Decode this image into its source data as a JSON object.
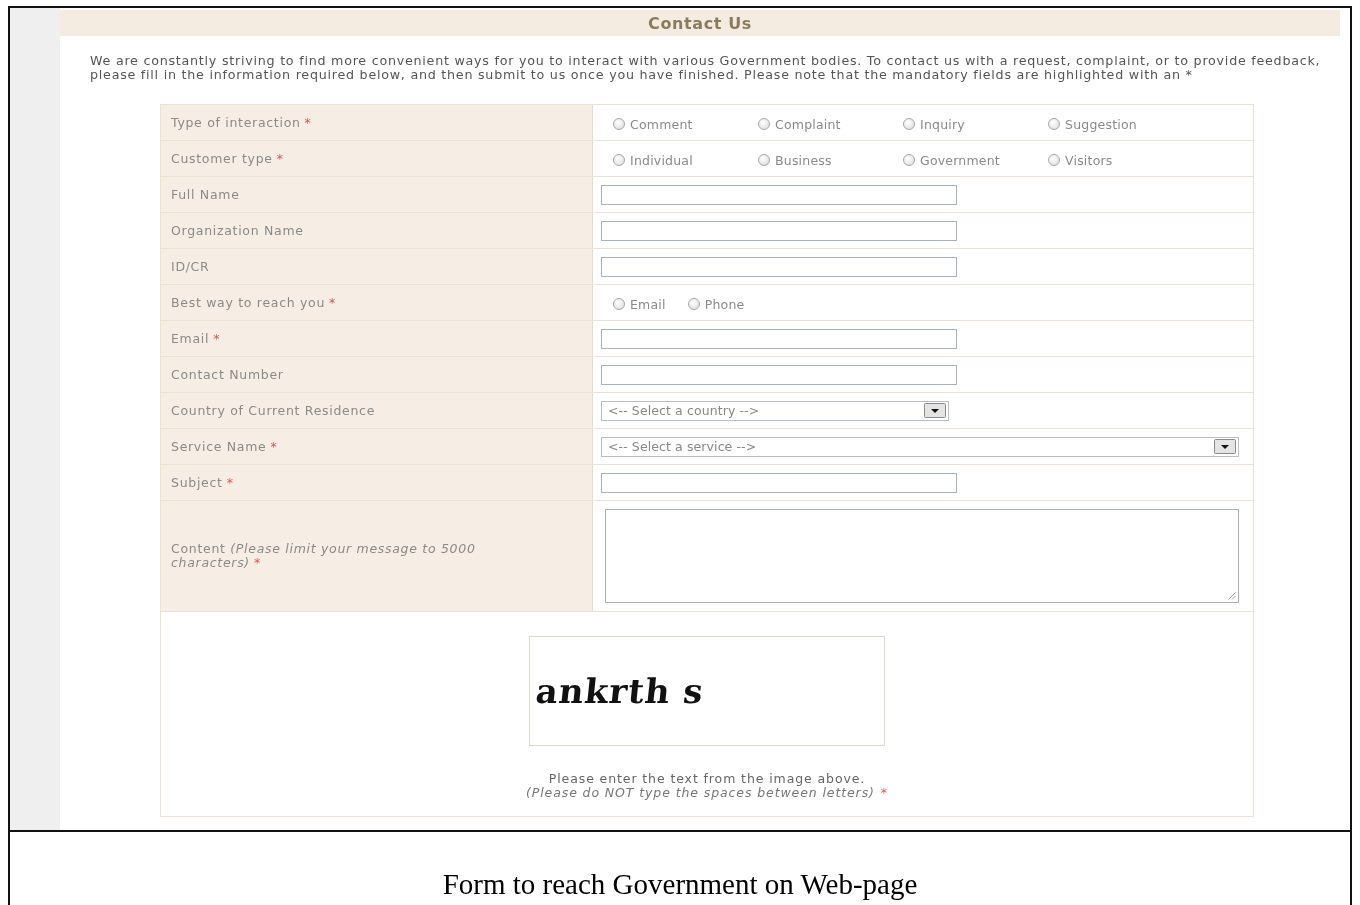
{
  "page": {
    "title": "Contact Us",
    "intro": "We are constantly striving to find more convenient ways for you to interact with various Government bodies. To contact us with a request, complaint, or to provide feedback, please fill in the information required below, and then submit to us once you have finished. Please note that the mandatory fields are highlighted with an *"
  },
  "fields": [
    {
      "kind": "radio",
      "label": "Type of interaction",
      "required_mark": "*",
      "options": [
        {
          "label": "Comment",
          "selected": false
        },
        {
          "label": "Complaint",
          "selected": false
        },
        {
          "label": "Inquiry",
          "selected": false
        },
        {
          "label": "Suggestion",
          "selected": false
        }
      ]
    },
    {
      "kind": "radio",
      "label": "Customer type",
      "required_mark": "*",
      "options": [
        {
          "label": "Individual",
          "selected": false
        },
        {
          "label": "Business",
          "selected": false
        },
        {
          "label": "Government",
          "selected": false
        },
        {
          "label": "Visitors",
          "selected": false
        }
      ]
    },
    {
      "kind": "text",
      "label": "Full Name"
    },
    {
      "kind": "text",
      "label": "Organization Name"
    },
    {
      "kind": "text",
      "label": "ID/CR"
    },
    {
      "kind": "radio",
      "label": "Best way to reach you",
      "required_mark": "*",
      "compact": true,
      "options": [
        {
          "label": "Email",
          "selected": false
        },
        {
          "label": "Phone",
          "selected": false
        }
      ]
    },
    {
      "kind": "text",
      "label": "Email",
      "required_mark": "*"
    },
    {
      "kind": "text",
      "label": "Contact Number"
    },
    {
      "kind": "select",
      "label": "Country of Current Residence",
      "value": "<-- Select a country -->",
      "wide": false
    },
    {
      "kind": "select",
      "label": "Service Name",
      "required_mark": "*",
      "value": "<-- Select a service -->",
      "wide": true
    },
    {
      "kind": "text",
      "label": "Subject",
      "required_mark": "*"
    },
    {
      "kind": "textarea",
      "label": "Content *(Please limit your message to 5000 characters)*",
      "required_mark": "*"
    }
  ],
  "captcha": {
    "image_text": "ankrth s",
    "hint": "Please enter the text from the image above.",
    "note": "(Please do NOT type the spaces between letters)",
    "required_mark": "*"
  },
  "caption": "Form to reach Government on Web-page"
}
